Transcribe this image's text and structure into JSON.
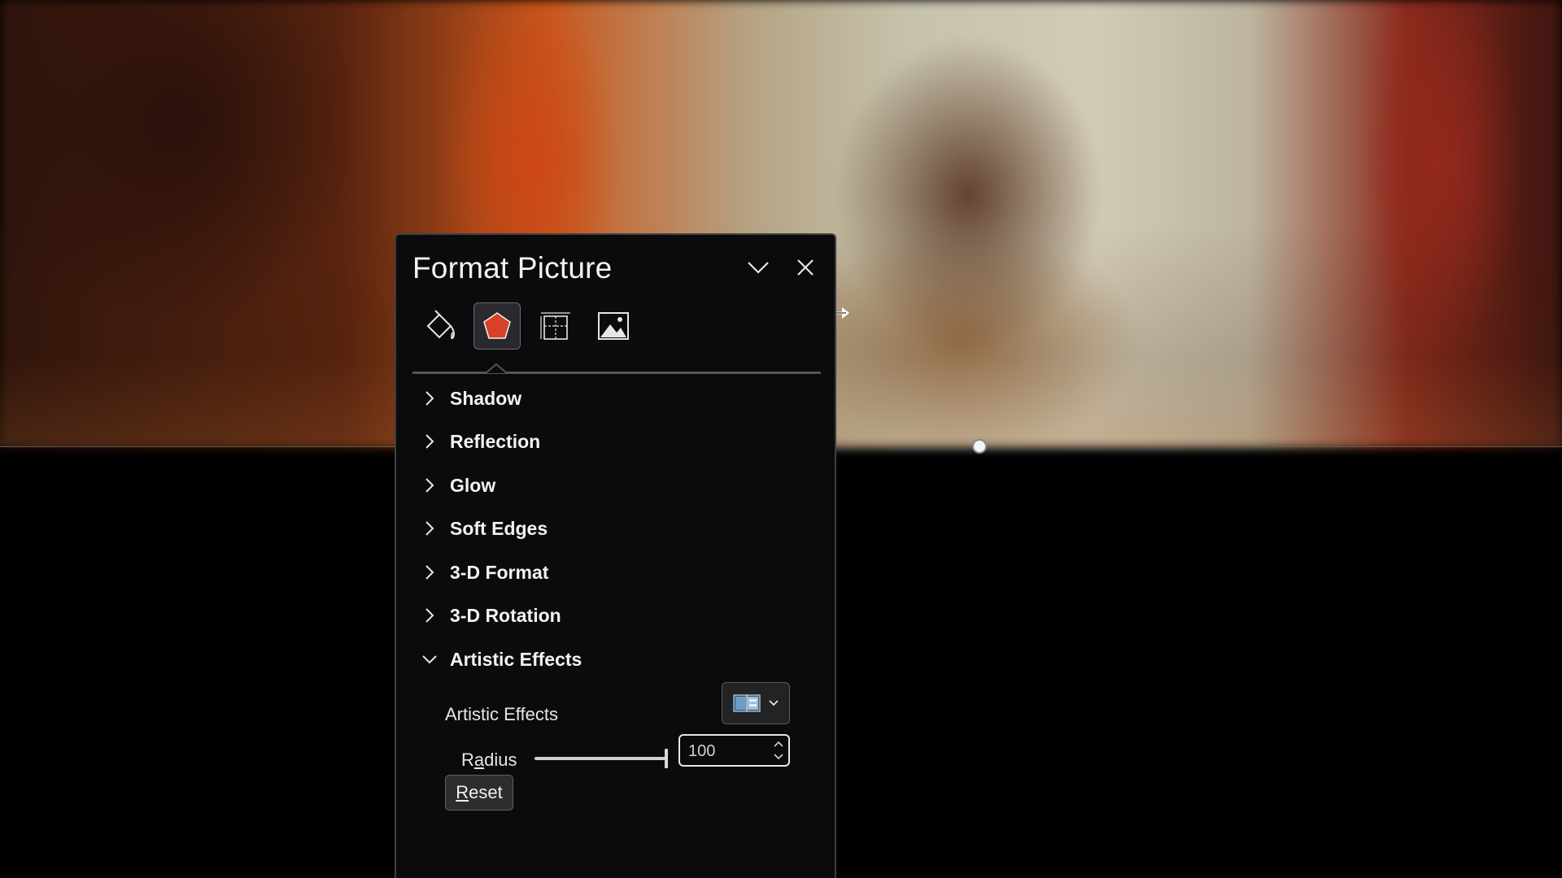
{
  "pane": {
    "title": "Format Picture",
    "tabs": [
      {
        "name": "Fill & Line",
        "icon": "paint-bucket-icon"
      },
      {
        "name": "Effects",
        "icon": "pentagon-icon",
        "active": true
      },
      {
        "name": "Size & Properties",
        "icon": "size-properties-icon"
      },
      {
        "name": "Picture",
        "icon": "picture-icon"
      }
    ],
    "sections": [
      {
        "label": "Shadow",
        "expanded": false
      },
      {
        "label": "Reflection",
        "expanded": false
      },
      {
        "label": "Glow",
        "expanded": false
      },
      {
        "label": "Soft Edges",
        "expanded": false
      },
      {
        "label": "3-D Format",
        "expanded": false
      },
      {
        "label": "3-D Rotation",
        "expanded": false
      },
      {
        "label": "Artistic Effects",
        "expanded": true
      }
    ],
    "artistic_effects": {
      "label": "Artistic Effects",
      "radius_label_pre": "R",
      "radius_label_u": "a",
      "radius_label_post": "dius",
      "radius_value": "100",
      "radius_slider_fraction": 1.0,
      "reset_u": "R",
      "reset_rest": "eset"
    }
  },
  "colors": {
    "accent_shape": "#d9402a",
    "pane_bg": "#0b0b0d"
  }
}
